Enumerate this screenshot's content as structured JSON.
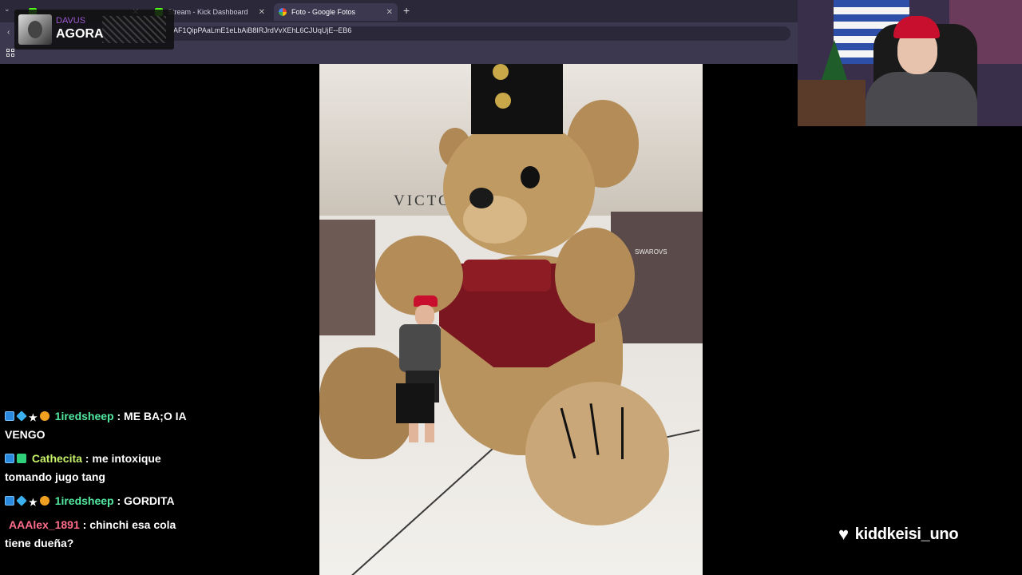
{
  "browser": {
    "tabs": [
      {
        "label": "",
        "active": false
      },
      {
        "label": "Stream - Kick Dashboard",
        "active": false
      },
      {
        "label": "Foto - Google Fotos",
        "active": true
      }
    ],
    "url": "AF1QipPAaLmE1eLbAiB8IRJrdVvXEhL6CJUqUjE--EB6",
    "new_tab_symbol": "+",
    "close_symbol": "✕"
  },
  "overlay_badge": {
    "user": "DAVUS",
    "text": "AGORA"
  },
  "photo": {
    "store_sign": "VICTO",
    "store_sign_right": "SWAROVS"
  },
  "chat": {
    "messages": [
      {
        "user": "1iredsheep",
        "text": "ME BA;O IA VENGO"
      },
      {
        "user": "Cathecita",
        "text": "me intoxique tomando jugo tang"
      },
      {
        "user": "1iredsheep",
        "text": "GORDITA"
      },
      {
        "user": "AAAlex_1891",
        "text": "chinchi esa cola tiene dueña?"
      }
    ],
    "separator": " : "
  },
  "follow_alert": {
    "username": "kiddkeisi_uno",
    "icon": "heart-icon"
  },
  "colors": {
    "tabbar": "#2a2839",
    "toolbar": "#3b3850",
    "user_green": "#53e8a0",
    "user_yellow": "#c7f26a",
    "user_pink": "#ff6d8a",
    "badge_user": "#9b59d0"
  }
}
